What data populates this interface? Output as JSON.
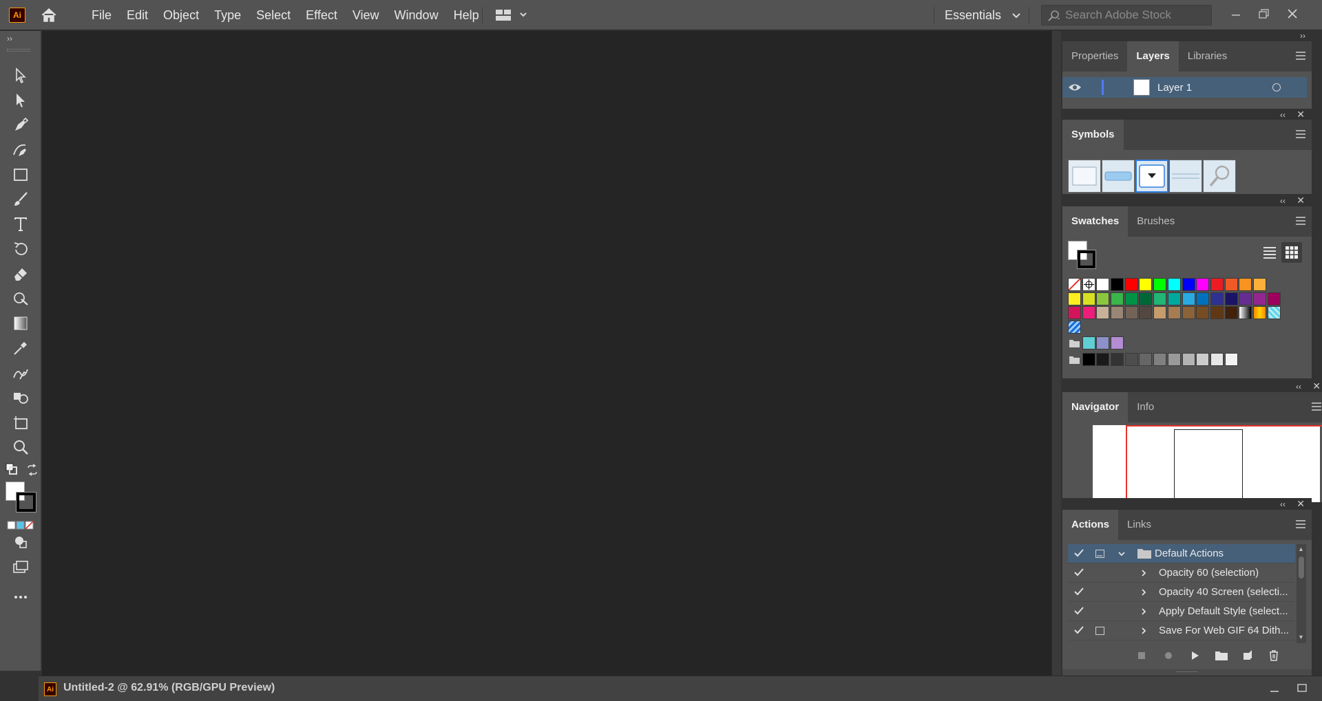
{
  "app": {
    "logo_text": "Ai",
    "brand_color": "#ff9a00"
  },
  "menu": [
    "File",
    "Edit",
    "Object",
    "Type",
    "Select",
    "Effect",
    "View",
    "Window",
    "Help"
  ],
  "workspace": {
    "label": "Essentials"
  },
  "search": {
    "placeholder": "Search Adobe Stock"
  },
  "document": {
    "tab_title": "Untitled-2 @ 62.91% (RGB/GPU Preview)"
  },
  "panels": {
    "top_tabs": [
      "Properties",
      "Layers",
      "Libraries"
    ],
    "layers": {
      "name": "Layer 1"
    },
    "symbols": {
      "title": "Symbols"
    },
    "swatches": {
      "tabs": [
        "Swatches",
        "Brushes"
      ]
    },
    "navigator": {
      "tabs": [
        "Navigator",
        "Info"
      ]
    },
    "actions": {
      "tabs": [
        "Actions",
        "Links"
      ],
      "set_name": "Default Actions",
      "items": [
        "Opacity 60 (selection)",
        "Opacity 40 Screen (selecti...",
        "Apply Default Style (select...",
        "Save For Web GIF 64 Dith..."
      ]
    }
  },
  "swatch_rows": [
    [
      "#ff0000",
      "#ffff00",
      "#00ff00",
      "#00ffff",
      "#0000ff",
      "#ff00ff",
      "#ed1c24",
      "#f15a24",
      "#f7931e",
      "#fbb03b"
    ],
    [
      "#fcee21",
      "#d9e021",
      "#8cc63f",
      "#39b54a",
      "#009245",
      "#006837",
      "#22b573",
      "#00a99d",
      "#29abe2",
      "#0071bc",
      "#2e3192",
      "#1b1464",
      "#662d91",
      "#93278f",
      "#9e005d"
    ],
    [
      "#d4145a",
      "#ed1e79",
      "#c7b299",
      "#998675",
      "#736357",
      "#534741",
      "#c69c6d",
      "#a67c52",
      "#8c6239",
      "#754c24",
      "#603813",
      "#42210b"
    ],
    [
      "#5fcfd3",
      "#8d90c9",
      "#b38cd3"
    ],
    [
      "#000000",
      "#1a1a1a",
      "#333333",
      "#4d4d4d",
      "#666666",
      "#808080",
      "#999999",
      "#b3b3b3",
      "#cccccc",
      "#e6e6e6",
      "#f2f2f2"
    ]
  ]
}
